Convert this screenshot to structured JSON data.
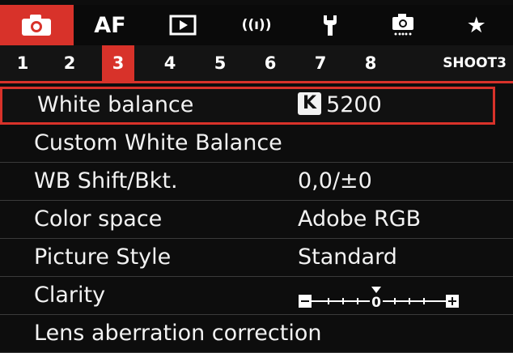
{
  "topbar": {
    "tabs": [
      {
        "id": "shoot",
        "icon": "camera-icon",
        "active": true
      },
      {
        "id": "af",
        "label": "AF"
      },
      {
        "id": "playback",
        "icon": "play-icon"
      },
      {
        "id": "wireless",
        "label": "((ı))",
        "icon": "wireless-icon"
      },
      {
        "id": "setup",
        "icon": "wrench-icon"
      },
      {
        "id": "custom",
        "icon": "custom-camera-icon"
      },
      {
        "id": "mymenu",
        "label": "★",
        "icon": "star-icon"
      }
    ],
    "accent_color": "#d8322a"
  },
  "pages": {
    "numbers": [
      "1",
      "2",
      "3",
      "4",
      "5",
      "6",
      "7",
      "8"
    ],
    "active": "3",
    "tab_name": "SHOOT3"
  },
  "menu": {
    "items": [
      {
        "label": "White balance",
        "badge": "K",
        "value": "5200",
        "selected": true
      },
      {
        "label": "Custom White Balance",
        "value": ""
      },
      {
        "label": "WB Shift/Bkt.",
        "value": "0,0/±0"
      },
      {
        "label": "Color space",
        "value": "Adobe RGB"
      },
      {
        "label": "Picture Style",
        "value": "Standard"
      },
      {
        "label": "Clarity",
        "value": "",
        "scale": {
          "min_label": "−",
          "max_label": "+",
          "zero_label": "0",
          "level": 0
        }
      },
      {
        "label": "Lens aberration correction",
        "value": ""
      }
    ]
  }
}
